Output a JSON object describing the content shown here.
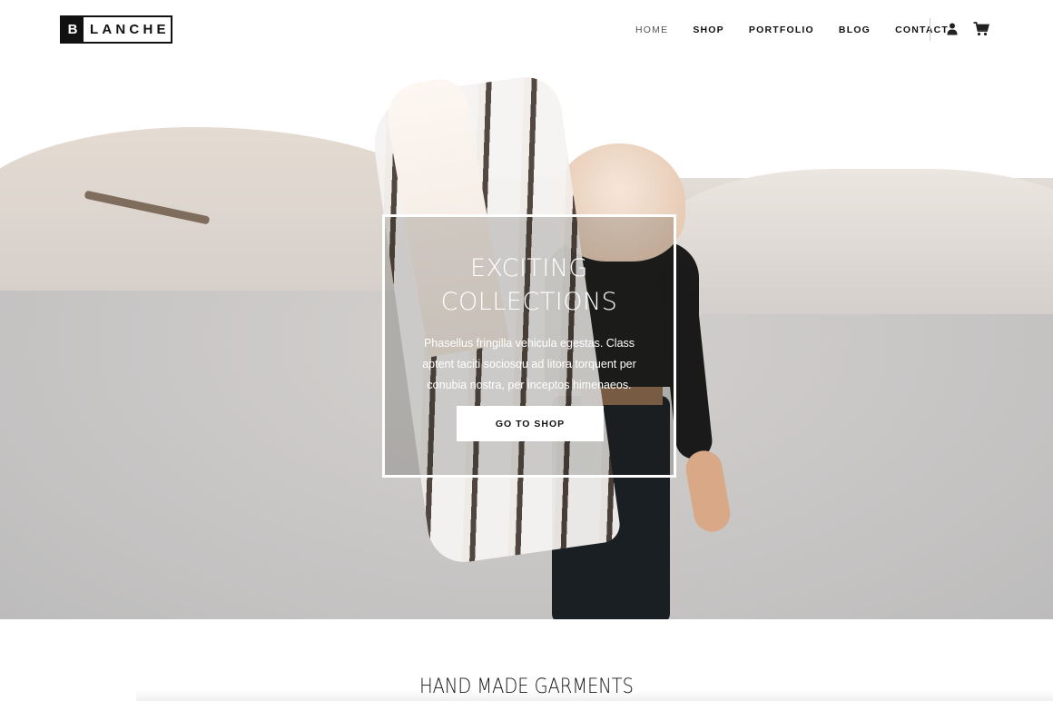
{
  "brand": {
    "logo_initial": "B",
    "logo_rest": "LANCHE",
    "colors": {
      "primary": "#111111",
      "background": "#ffffff",
      "nav_active": "#555555"
    }
  },
  "nav": {
    "items": [
      {
        "label": "HOME",
        "active": true
      },
      {
        "label": "SHOP",
        "active": false
      },
      {
        "label": "PORTFOLIO",
        "active": false
      },
      {
        "label": "BLOG",
        "active": false
      },
      {
        "label": "CONTACT",
        "active": false
      }
    ],
    "icons": {
      "account": "user-icon",
      "cart": "cart-icon"
    }
  },
  "hero": {
    "title_line1": "EXCITING",
    "title_line2": "COLLECTIONS",
    "description": "Phasellus fringilla vehicula egestas. Class aptent taciti sociosqu ad litora torquent per conubia nostra, per inceptos himenaeos.",
    "button_label": "GO TO SHOP"
  },
  "section": {
    "title": "HAND MADE GARMENTS"
  }
}
